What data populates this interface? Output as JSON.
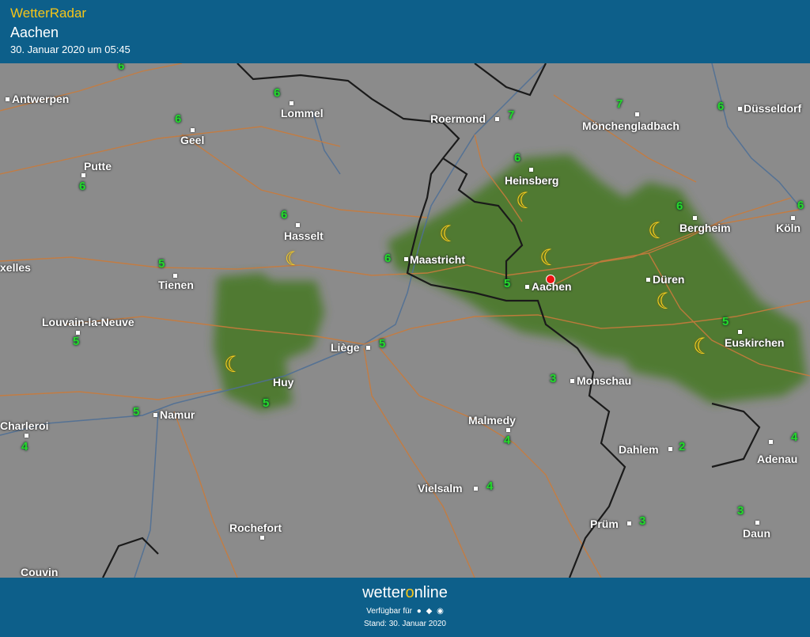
{
  "header": {
    "app_title": "WetterRadar",
    "place": "Aachen",
    "datetime": "30. Januar 2020 um 05:45"
  },
  "map": {
    "cities": [
      "Antwerpen",
      "Lommel",
      "Roermond",
      "Mönchengladbach",
      "Düsseldorf",
      "Geel",
      "Putte",
      "Heinsberg",
      "Hasselt",
      "Maastricht",
      "Bergheim",
      "Köln",
      "xelles",
      "Tienen",
      "Aachen",
      "Düren",
      "Louvain-la-Neuve",
      "Liège",
      "Euskirchen",
      "Monschau",
      "Huy",
      "Namur",
      "Charleroi",
      "Malmedy",
      "Dahlem",
      "Adenau",
      "Vielsalm",
      "Prüm",
      "Rochefort",
      "Daun",
      "Couvin"
    ],
    "temperatures": [
      "6",
      "6",
      "7",
      "7",
      "6",
      "6",
      "6",
      "6",
      "6",
      "6",
      "6",
      "5",
      "5",
      "5",
      "6",
      "5",
      "5",
      "3",
      "5",
      "5",
      "4",
      "2",
      "4",
      "4",
      "3",
      "3",
      "4"
    ],
    "weather_icon": "moon-icon",
    "location_marker": "location-pin-icon",
    "colors": {
      "precipitation": "#4e7a2e",
      "background": "#8b8b8b",
      "roads": "#c97b3c",
      "rivers": "#4f6f95",
      "borders": "#1a1a1a",
      "temperature": "#27d82a"
    }
  },
  "footer": {
    "brand_pre": "wetter",
    "brand_accent": "o",
    "brand_post": "nline",
    "availability": "Verfügbar für",
    "os_icons": [
      "android-icon",
      "apple-icon",
      "web-icon"
    ],
    "stand": "Stand: 30. Januar 2020"
  }
}
